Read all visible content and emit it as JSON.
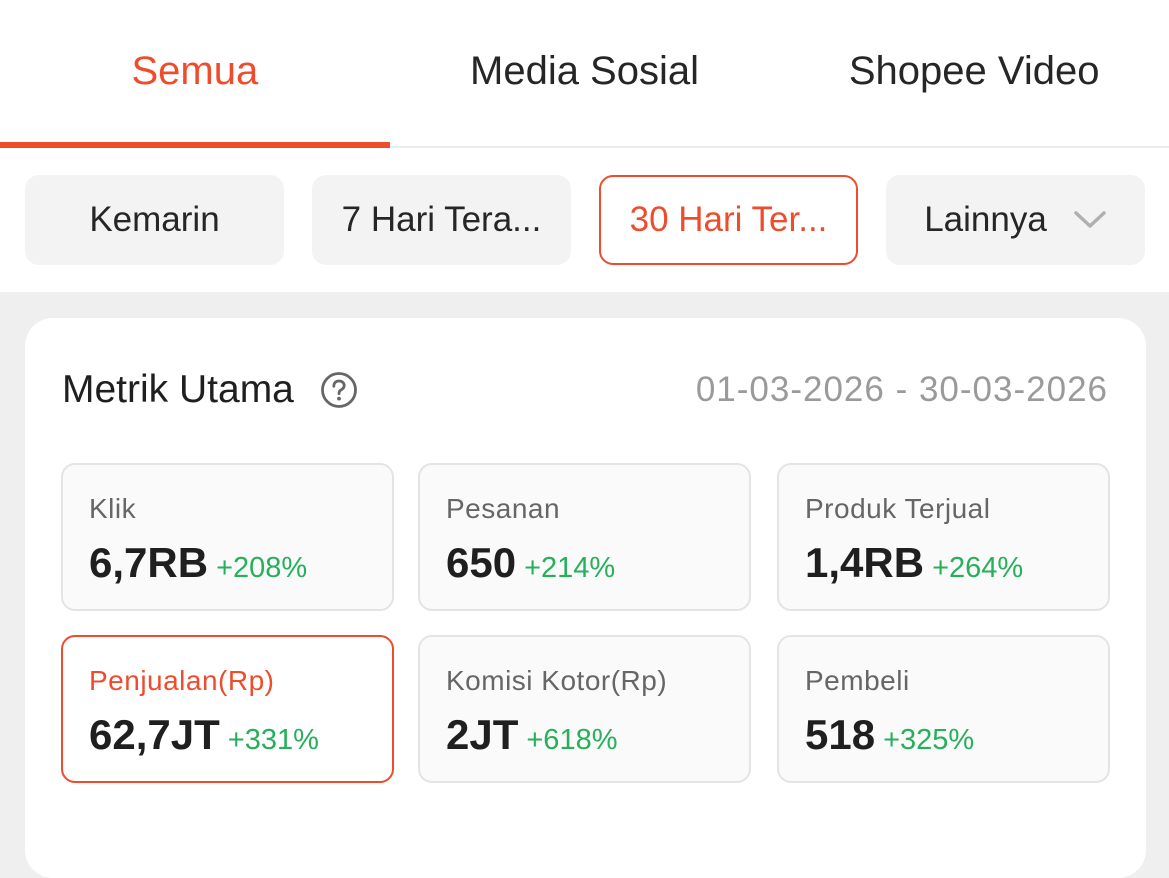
{
  "tabs": [
    {
      "label": "Semua",
      "active": true
    },
    {
      "label": "Media Sosial",
      "active": false
    },
    {
      "label": "Shopee Video",
      "active": false
    }
  ],
  "filters": {
    "yesterday": "Kemarin",
    "last7": "7 Hari Tera...",
    "last30": "30 Hari Ter...",
    "more": "Lainnya",
    "active": "last30"
  },
  "card": {
    "title": "Metrik Utama",
    "help_icon": "question-circle-icon",
    "date_range": "01-03-2026 - 30-03-2026"
  },
  "metrics": [
    {
      "label": "Klik",
      "value": "6,7RB",
      "change": "+208%"
    },
    {
      "label": "Pesanan",
      "value": "650",
      "change": "+214%"
    },
    {
      "label": "Produk Terjual",
      "value": "1,4RB",
      "change": "+264%"
    },
    {
      "label": "Penjualan(Rp)",
      "value": "62,7JT",
      "change": "+331%",
      "active": true
    },
    {
      "label": "Komisi Kotor(Rp)",
      "value": "2JT",
      "change": "+618%"
    },
    {
      "label": "Pembeli",
      "value": "518",
      "change": "+325%"
    }
  ],
  "colors": {
    "accent": "#ee4d2d",
    "positive": "#27b05b",
    "text": "#1f1f1f",
    "muted": "#9a9a9a",
    "page_bg": "#efefef"
  }
}
